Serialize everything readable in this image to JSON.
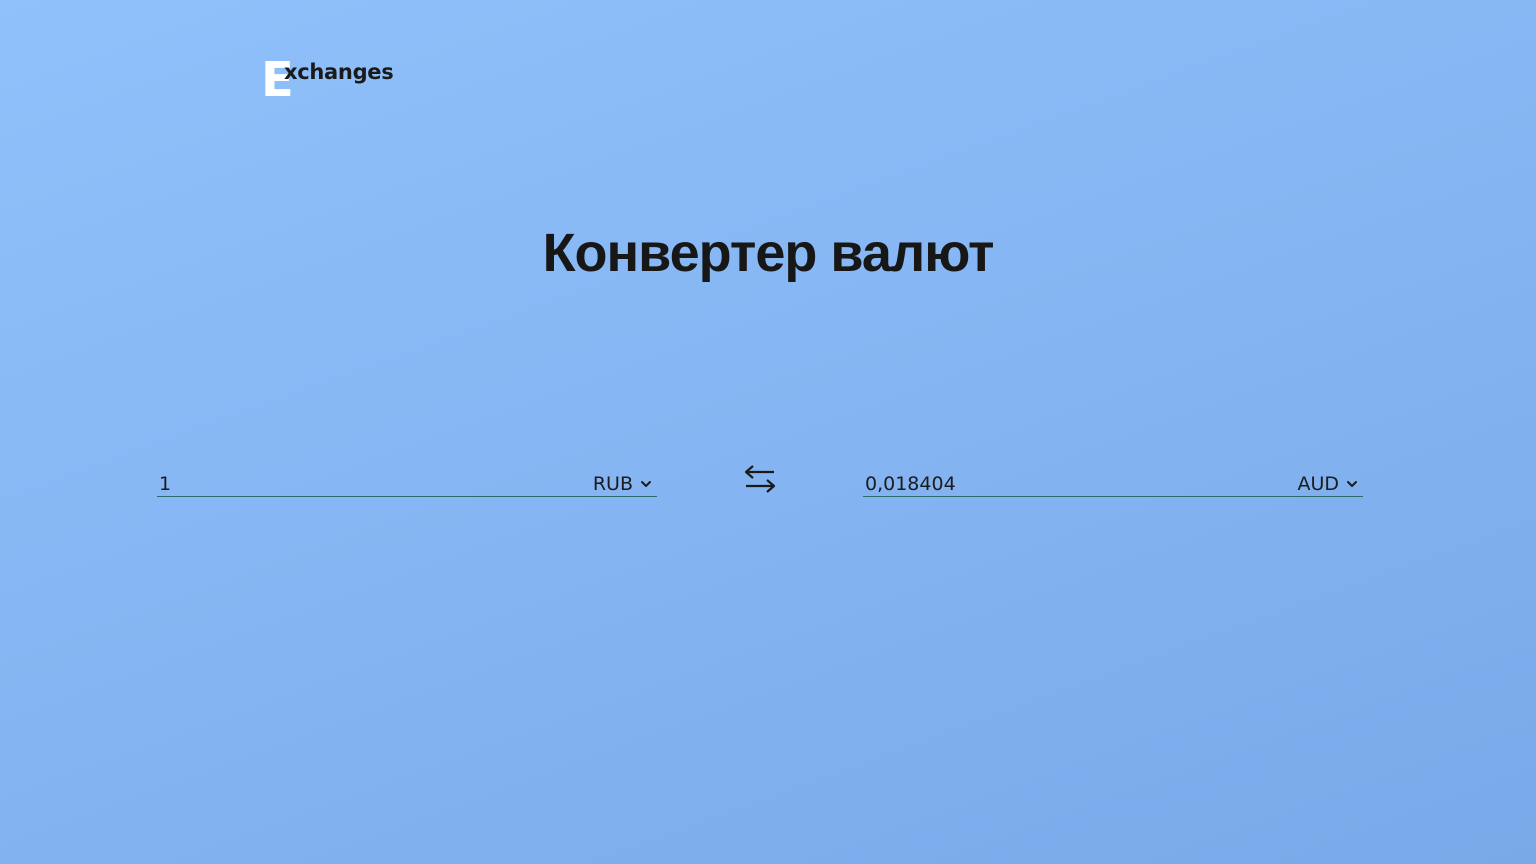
{
  "header": {
    "logo_letter": "E",
    "logo_text": "xchanges"
  },
  "main": {
    "title": "Конвертер валют"
  },
  "converter": {
    "from": {
      "amount": "1",
      "currency": "RUB"
    },
    "to": {
      "amount": "0,018404",
      "currency": "AUD"
    },
    "swap_icon": "swap-arrows-icon",
    "dropdown_icon": "chevron-down-icon"
  },
  "colors": {
    "background_top": "#90c1fb",
    "background_bottom": "#79a9e8",
    "underline": "#2a6b6b",
    "text": "#1a1a1a",
    "logo_letter": "#ffffff"
  }
}
